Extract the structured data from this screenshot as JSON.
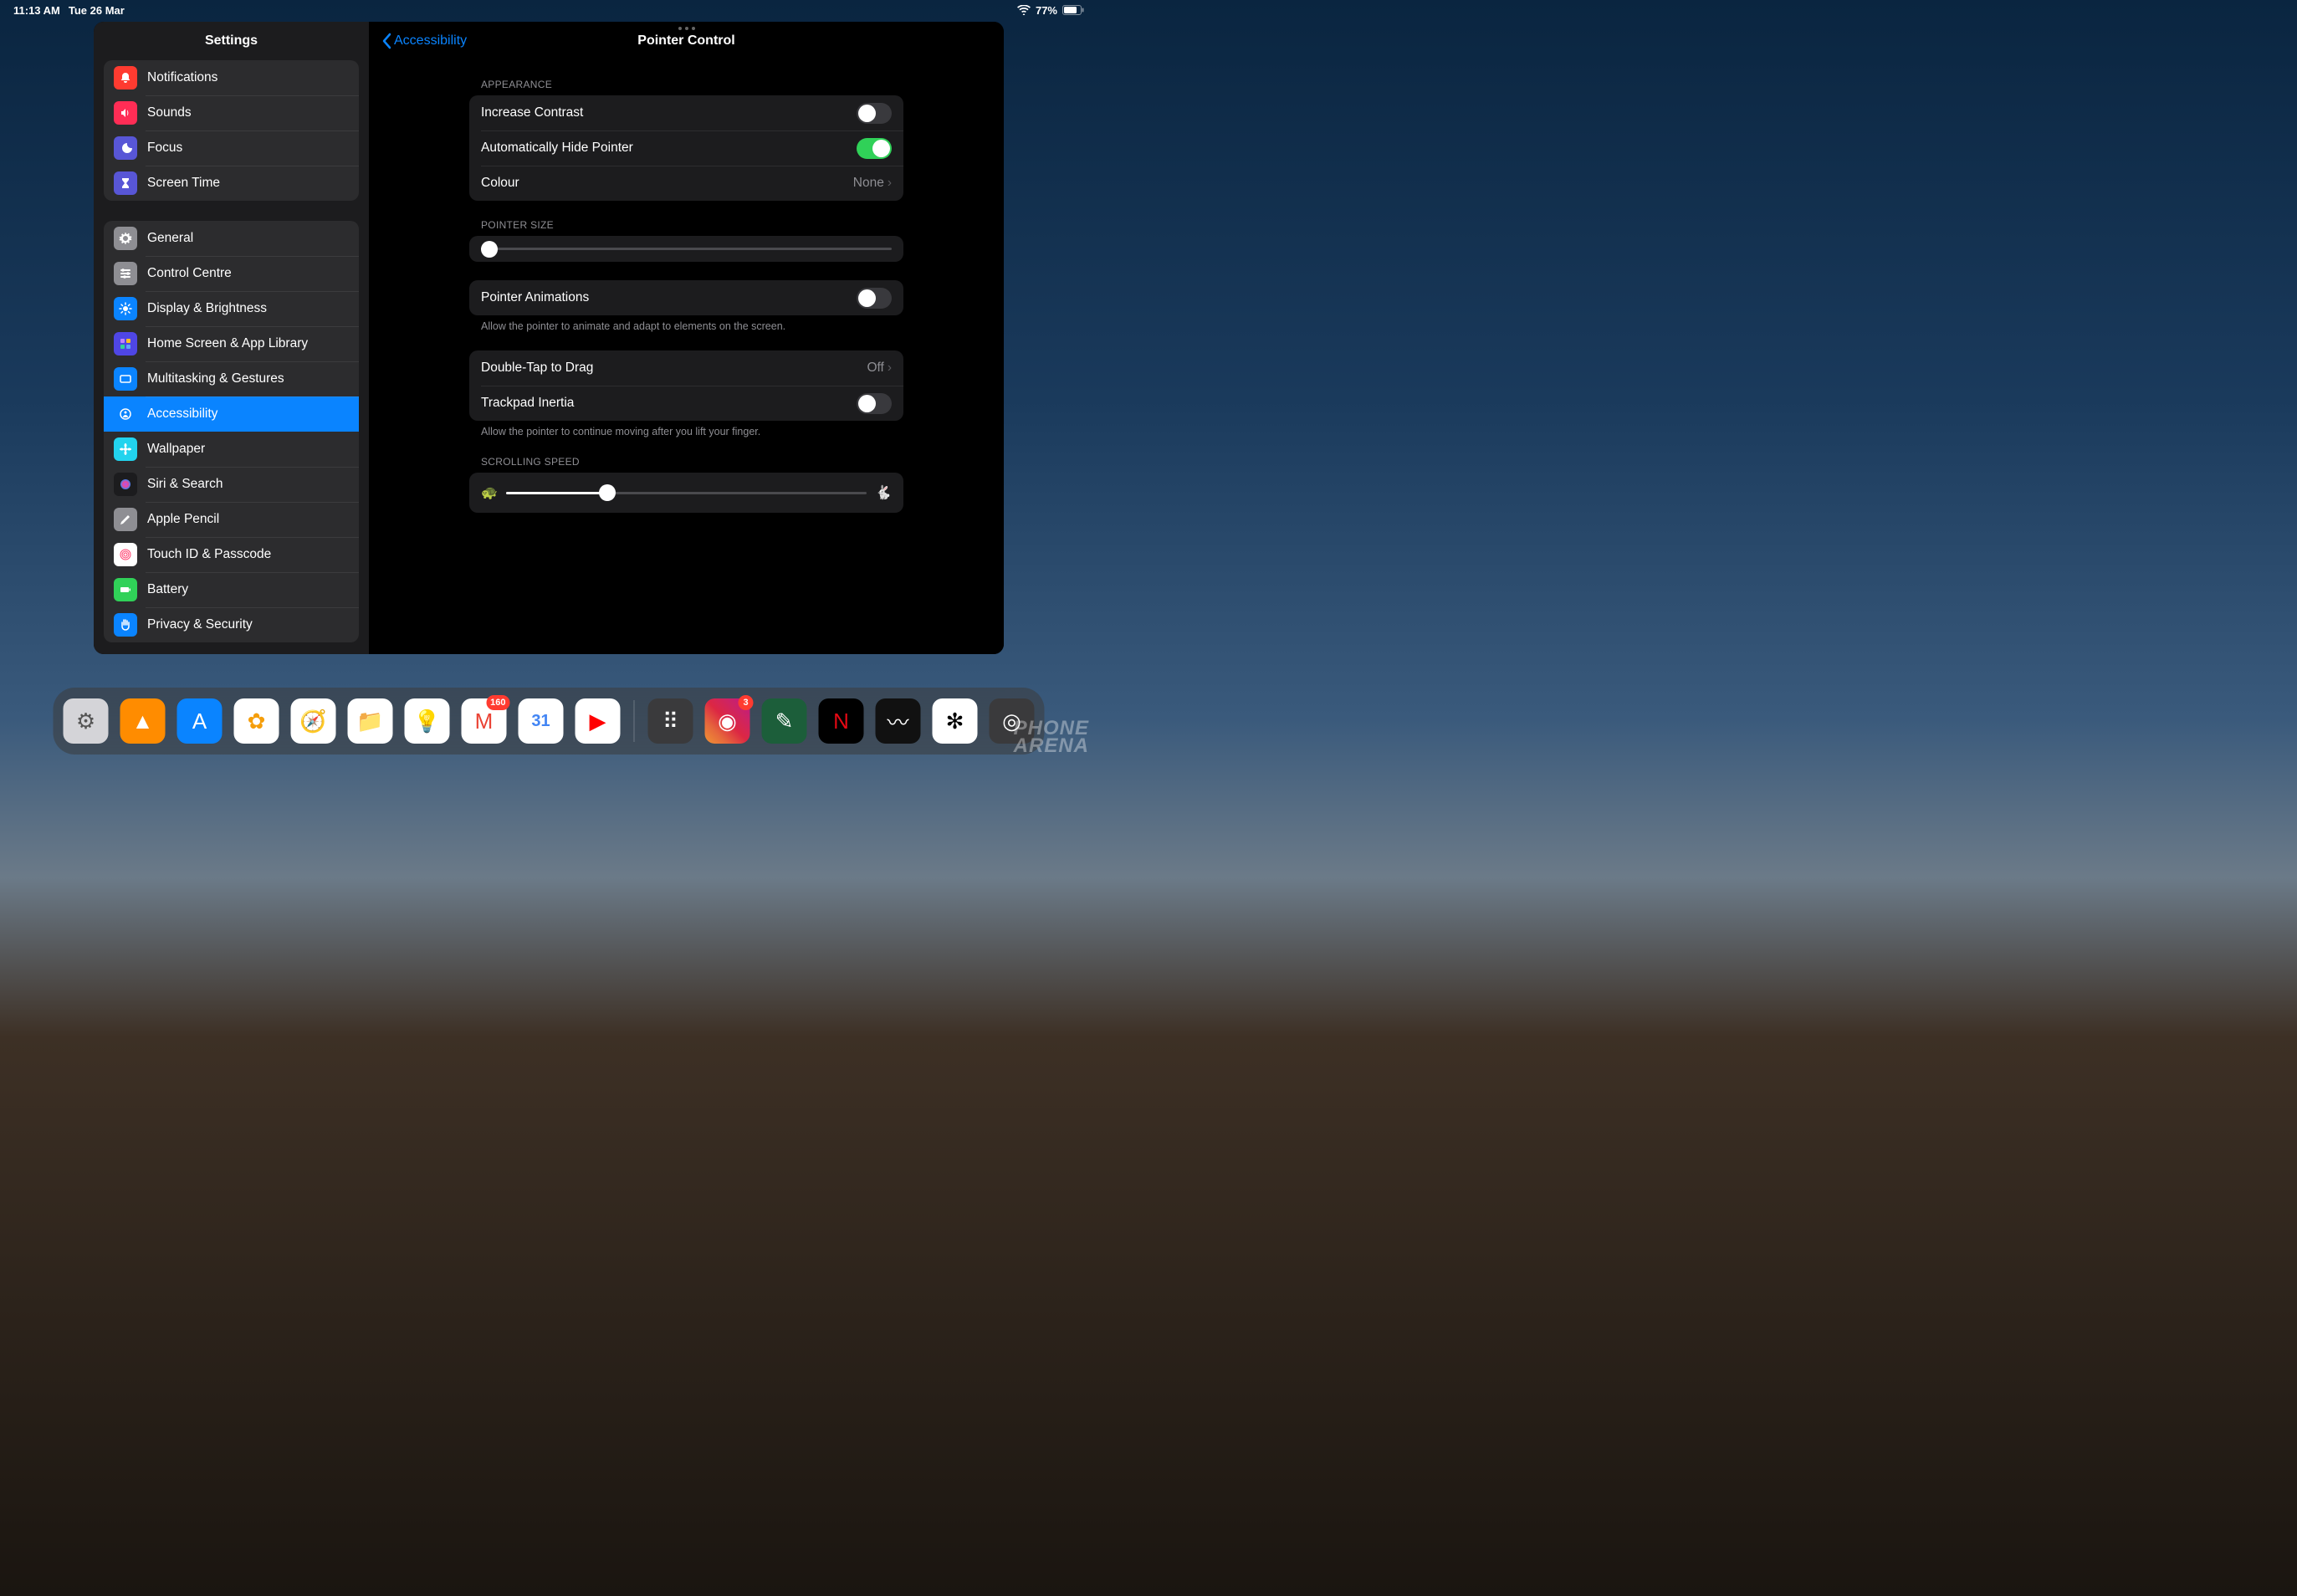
{
  "statusbar": {
    "time": "11:13 AM",
    "date": "Tue 26 Mar",
    "battery_pct": "77%"
  },
  "sidebar": {
    "title": "Settings",
    "groups": [
      [
        {
          "label": "Notifications",
          "icon_bg": "#ff3b30",
          "icon": "bell"
        },
        {
          "label": "Sounds",
          "icon_bg": "#ff2d55",
          "icon": "speaker"
        },
        {
          "label": "Focus",
          "icon_bg": "#5856d6",
          "icon": "moon"
        },
        {
          "label": "Screen Time",
          "icon_bg": "#5856d6",
          "icon": "hourglass"
        }
      ],
      [
        {
          "label": "General",
          "icon_bg": "#8e8e93",
          "icon": "gear"
        },
        {
          "label": "Control Centre",
          "icon_bg": "#8e8e93",
          "icon": "sliders"
        },
        {
          "label": "Display & Brightness",
          "icon_bg": "#0a84ff",
          "icon": "sun"
        },
        {
          "label": "Home Screen & App Library",
          "icon_bg": "#4f46e5",
          "icon": "grid"
        },
        {
          "label": "Multitasking & Gestures",
          "icon_bg": "#0a84ff",
          "icon": "rect"
        },
        {
          "label": "Accessibility",
          "icon_bg": "#0a84ff",
          "icon": "person",
          "selected": true
        },
        {
          "label": "Wallpaper",
          "icon_bg": "#22d3ee",
          "icon": "flower"
        },
        {
          "label": "Siri & Search",
          "icon_bg": "#1c1c1e",
          "icon": "siri"
        },
        {
          "label": "Apple Pencil",
          "icon_bg": "#8e8e93",
          "icon": "pencil"
        },
        {
          "label": "Touch ID & Passcode",
          "icon_bg": "#ffffff",
          "icon": "touchid"
        },
        {
          "label": "Battery",
          "icon_bg": "#30d158",
          "icon": "batt"
        },
        {
          "label": "Privacy & Security",
          "icon_bg": "#0a84ff",
          "icon": "hand"
        }
      ]
    ]
  },
  "detail": {
    "back_label": "Accessibility",
    "title": "Pointer Control",
    "sections": {
      "appearance_label": "APPEARANCE",
      "increase_contrast": {
        "label": "Increase Contrast",
        "on": false
      },
      "auto_hide": {
        "label": "Automatically Hide Pointer",
        "on": true
      },
      "colour": {
        "label": "Colour",
        "value": "None"
      },
      "pointer_size_label": "POINTER SIZE",
      "pointer_size_value": 2,
      "pointer_animations": {
        "label": "Pointer Animations",
        "on": false
      },
      "pointer_animations_footer": "Allow the pointer to animate and adapt to elements on the screen.",
      "double_tap": {
        "label": "Double-Tap to Drag",
        "value": "Off"
      },
      "trackpad_inertia": {
        "label": "Trackpad Inertia",
        "on": false
      },
      "trackpad_footer": "Allow the pointer to continue moving after you lift your finger.",
      "scrolling_label": "SCROLLING SPEED",
      "scrolling_value": 28
    }
  },
  "dock": {
    "apps_left": [
      {
        "name": "settings",
        "bg": "#d4d4d8",
        "glyph": "⚙︎",
        "fg": "#555"
      },
      {
        "name": "vlc",
        "bg": "#ff8c00",
        "glyph": "▲"
      },
      {
        "name": "appstore",
        "bg": "#0a84ff",
        "glyph": "A"
      },
      {
        "name": "photos",
        "bg": "#ffffff",
        "glyph": "✿",
        "fg": "#f59e0b"
      },
      {
        "name": "safari",
        "bg": "#ffffff",
        "glyph": "🧭"
      },
      {
        "name": "files",
        "bg": "#ffffff",
        "glyph": "📁"
      },
      {
        "name": "keep",
        "bg": "#ffffff",
        "glyph": "💡"
      },
      {
        "name": "gmail",
        "bg": "#ffffff",
        "glyph": "M",
        "fg": "#ea4335",
        "badge": "160"
      },
      {
        "name": "calendar",
        "bg": "#ffffff",
        "glyph": "31",
        "fg": "#4285f4"
      },
      {
        "name": "youtube",
        "bg": "#ffffff",
        "glyph": "▶",
        "fg": "#ff0000"
      }
    ],
    "apps_right": [
      {
        "name": "folder",
        "bg": "#3a3a3c",
        "glyph": "⠿"
      },
      {
        "name": "instagram",
        "bg": "linear-gradient(45deg,#f09433,#e6683c,#dc2743,#cc2366,#bc1888)",
        "glyph": "◉",
        "badge": "3"
      },
      {
        "name": "freeform",
        "bg": "#1c5e3a",
        "glyph": "✎"
      },
      {
        "name": "netflix",
        "bg": "#000000",
        "glyph": "N",
        "fg": "#e50914"
      },
      {
        "name": "procreate",
        "bg": "#111111",
        "glyph": "〰"
      },
      {
        "name": "chatgpt",
        "bg": "#ffffff",
        "glyph": "✻",
        "fg": "#000"
      },
      {
        "name": "camera",
        "bg": "#3a3a3c",
        "glyph": "◎"
      }
    ]
  },
  "watermark": {
    "line1": "PHONE",
    "line2": "ARENA"
  }
}
